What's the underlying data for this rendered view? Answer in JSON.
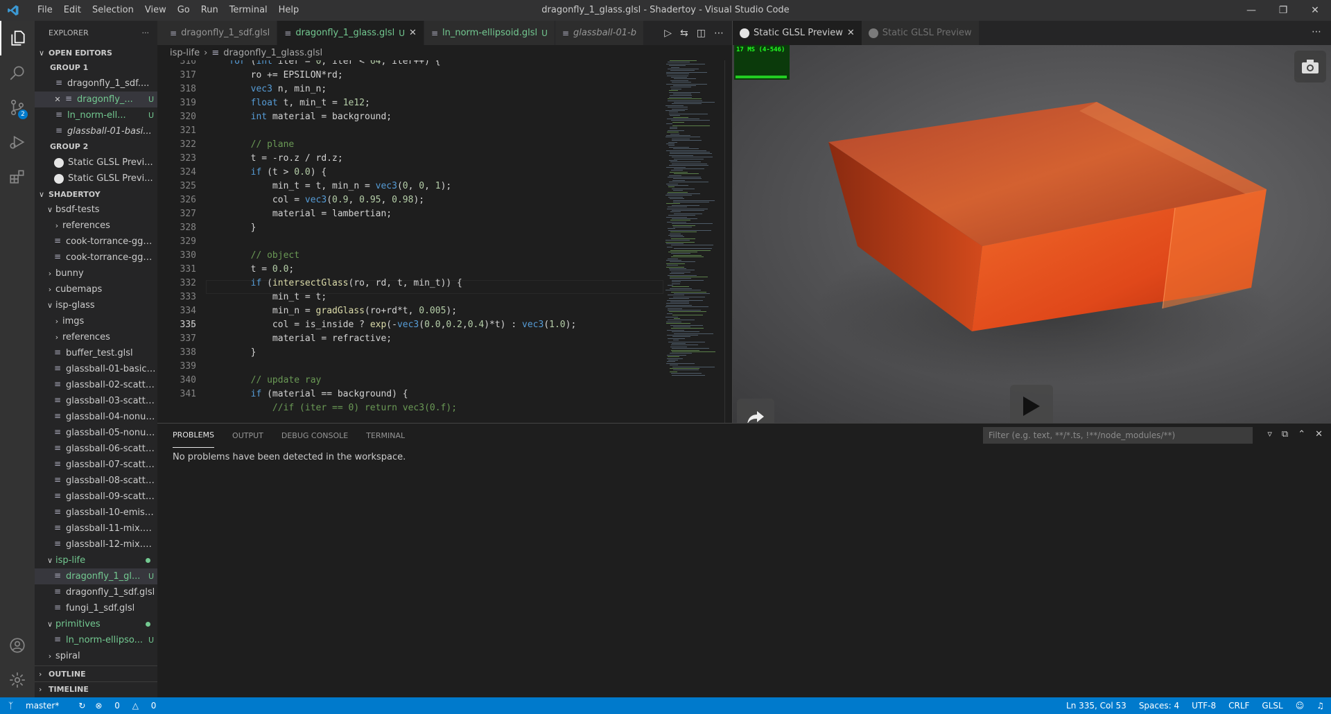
{
  "window_title": "dragonfly_1_glass.glsl - Shadertoy - Visual Studio Code",
  "menu": [
    "File",
    "Edit",
    "Selection",
    "View",
    "Go",
    "Run",
    "Terminal",
    "Help"
  ],
  "activity": {
    "scm_badge": "2"
  },
  "explorer": {
    "title": "EXPLORER",
    "more": "···",
    "open_editors_label": "OPEN EDITORS",
    "group1_label": "GROUP 1",
    "group1": [
      {
        "label": "dragonfly_1_sdf....",
        "status": ""
      },
      {
        "label": "dragonfly_...",
        "status": "U"
      },
      {
        "label": "ln_norm-ell...",
        "status": "U"
      },
      {
        "label": "glassball-01-basi...",
        "status": ""
      }
    ],
    "group2_label": "GROUP 2",
    "group2": [
      "Static GLSL Previ...",
      "Static GLSL Previ..."
    ],
    "shadertoy_label": "SHADERTOY",
    "tree": [
      "bsdf-tests",
      "references",
      "cook-torrance-ggx-i...",
      "cook-torrance-ggx.g...",
      "bunny",
      "cubemaps",
      "isp-glass",
      "imgs",
      "references",
      "buffer_test.glsl",
      "glassball-01-basic.glsl",
      "glassball-02-scatter....",
      "glassball-03-scatter....",
      "glassball-04-nonunif...",
      "glassball-05-nonunif...",
      "glassball-06-scatter_...",
      "glassball-07-scatter....",
      "glassball-08-scatter....",
      "glassball-09-scatter....",
      "glassball-10-emissio...",
      "glassball-11-mix.glsl",
      "glassball-12-mix.glsl",
      "isp-life",
      "dragonfly_1_gl...",
      "dragonfly_1_sdf.glsl",
      "fungi_1_sdf.glsl",
      "primitives",
      "ln_norm-ellipso...",
      "spiral"
    ],
    "status_u": "U",
    "outline_label": "OUTLINE",
    "timeline_label": "TIMELINE"
  },
  "tabs": [
    {
      "label": "dragonfly_1_sdf.glsl"
    },
    {
      "label": "dragonfly_1_glass.glsl",
      "status": "U"
    },
    {
      "label": "ln_norm-ellipsoid.glsl",
      "status": "U"
    },
    {
      "label": "glassball-01-b"
    }
  ],
  "breadcrumb": [
    "isp-life",
    "dragonfly_1_glass.glsl"
  ],
  "code": {
    "line_numbers": [
      "316",
      "317",
      "318",
      "319",
      "320",
      "321",
      "322",
      "323",
      "324",
      "325",
      "326",
      "327",
      "328",
      "329",
      "330",
      "331",
      "332",
      "333",
      "334",
      "335",
      "336",
      "337",
      "338",
      "339",
      "340",
      "341"
    ],
    "current_line": "335"
  },
  "preview": {
    "tabs": [
      "Static GLSL Preview",
      "Static GLSL Preview"
    ],
    "fps": "17 MS (4-546)"
  },
  "panel": {
    "tabs": [
      "PROBLEMS",
      "OUTPUT",
      "DEBUG CONSOLE",
      "TERMINAL"
    ],
    "filter_placeholder": "Filter (e.g. text, **/*.ts, !**/node_modules/**)",
    "message": "No problems have been detected in the workspace."
  },
  "statusbar": {
    "branch": "master*",
    "errors": "0",
    "warnings": "0",
    "position": "Ln 335, Col 53",
    "spaces": "Spaces: 4",
    "encoding": "UTF-8",
    "eol": "CRLF",
    "language": "GLSL"
  }
}
